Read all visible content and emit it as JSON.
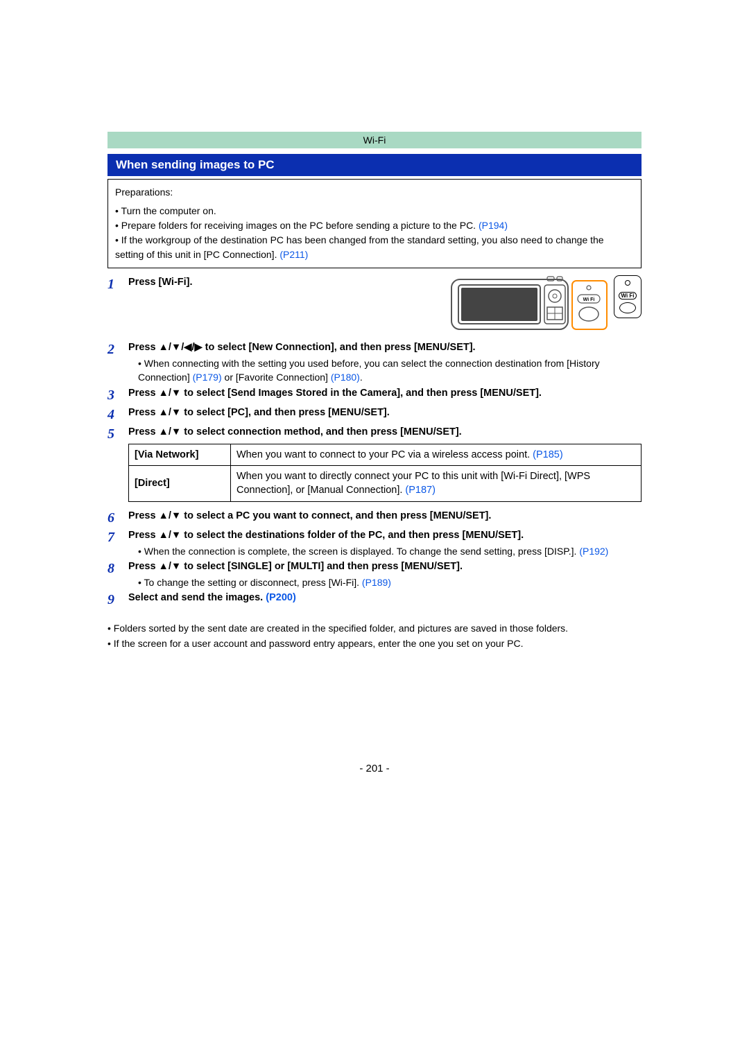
{
  "topbar": "Wi-Fi",
  "section_title": "When sending images to PC",
  "prep": {
    "label": "Preparations:",
    "b1": "• Turn the computer on.",
    "b2a": "• Prepare folders for receiving images on the PC before sending a picture to the PC. ",
    "b2link": "(P194)",
    "b3a": "• If the workgroup of the destination PC has been changed from the standard setting, you also need to change the setting of this unit in [PC Connection]. ",
    "b3link": "(P211)"
  },
  "steps": {
    "s1": {
      "num": "1",
      "head": "Press [Wi-Fi]."
    },
    "s2": {
      "num": "2",
      "head": "Press ▲/▼/◀/▶ to select [New Connection], and then press [MENU/SET].",
      "note_a": "• When connecting with the setting you used before, you can select the connection destination from [History Connection] ",
      "link1": "(P179)",
      "note_b": " or [Favorite Connection] ",
      "link2": "(P180)",
      "note_c": "."
    },
    "s3": {
      "num": "3",
      "head": "Press ▲/▼ to select [Send Images Stored in the Camera], and then press [MENU/SET]."
    },
    "s4": {
      "num": "4",
      "head": "Press ▲/▼ to select [PC], and then press [MENU/SET]."
    },
    "s5": {
      "num": "5",
      "head": "Press ▲/▼ to select connection method, and then press [MENU/SET]."
    },
    "table": {
      "r1k": "[Via Network]",
      "r1va": "When you want to connect to your PC via a wireless access point. ",
      "r1link": "(P185)",
      "r2k": "[Direct]",
      "r2va": "When you want to directly connect your PC to this unit with [Wi-Fi Direct], [WPS Connection], or [Manual Connection]. ",
      "r2link": "(P187)"
    },
    "s6": {
      "num": "6",
      "head": "Press ▲/▼ to select a PC you want to connect, and then press [MENU/SET]."
    },
    "s7": {
      "num": "7",
      "head": "Press ▲/▼ to select the destinations folder of the PC, and then press [MENU/SET].",
      "note_a": "• When the connection is complete, the screen is displayed. To change the send setting, press [DISP.]. ",
      "link": "(P192)"
    },
    "s8": {
      "num": "8",
      "head": "Press ▲/▼ to select [SINGLE] or [MULTI] and then press [MENU/SET].",
      "note_a": "• To change the setting or disconnect, press [Wi-Fi]. ",
      "link": "(P189)"
    },
    "s9": {
      "num": "9",
      "head_a": "Select and send the images. ",
      "link": "(P200)"
    }
  },
  "wifi_badge_label": "Wi Fi",
  "notes": {
    "n1": "• Folders sorted by the sent date are created in the specified folder, and pictures are saved in those folders.",
    "n2": "• If the screen for a user account and password entry appears, enter the one you set on your PC."
  },
  "page_number": "- 201 -"
}
